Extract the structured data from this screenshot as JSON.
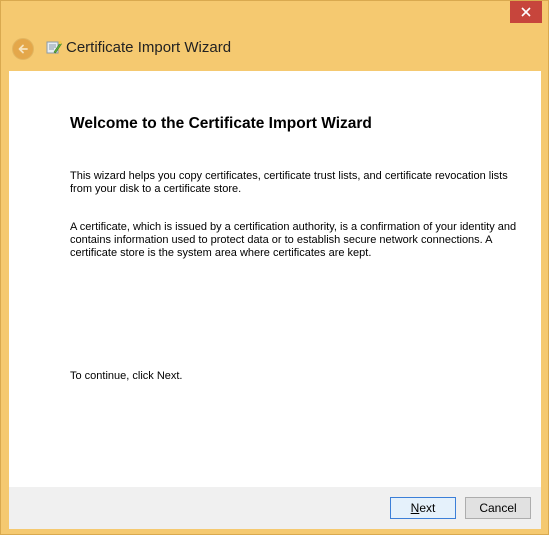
{
  "window": {
    "title": "Certificate Import Wizard",
    "close_label": "Close"
  },
  "main": {
    "heading": "Welcome to the Certificate Import Wizard",
    "paragraph1": "This wizard helps you copy certificates, certificate trust lists, and certificate revocation lists from your disk to a certificate store.",
    "paragraph2": "A certificate, which is issued by a certification authority, is a confirmation of your identity and contains information used to protect data or to establish secure network connections. A certificate store is the system area where certificates are kept.",
    "paragraph3": "To continue, click Next."
  },
  "buttons": {
    "next_first": "N",
    "next_rest": "ext",
    "cancel": "Cancel"
  },
  "colors": {
    "frame": "#f5c970",
    "close_button": "#c7453c",
    "content_bg": "#ffffff",
    "footer_bg": "#f0f0f0",
    "default_button_border": "#3c7fd8"
  },
  "icons": {
    "close": "close-icon",
    "back": "back-arrow-icon",
    "wizard": "certificate-wizard-icon"
  }
}
